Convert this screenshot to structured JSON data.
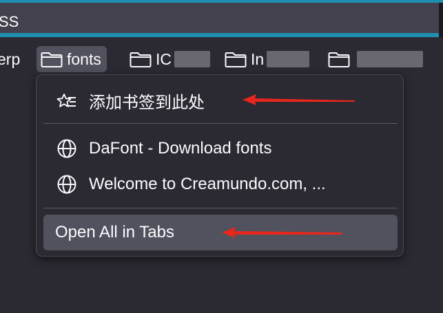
{
  "url_bar": {
    "text": "SS"
  },
  "bookmarks": [
    {
      "label": "erp"
    },
    {
      "label": "fonts"
    },
    {
      "label": "IC"
    },
    {
      "label": "In"
    },
    {
      "label": ""
    }
  ],
  "menu": {
    "items": [
      {
        "label": "添加书签到此处",
        "icon": "bookmark-add-icon"
      },
      {
        "label": "DaFont - Download fonts",
        "icon": "globe-icon"
      },
      {
        "label": "Welcome to Creamundo.com, ...",
        "icon": "globe-icon"
      },
      {
        "label": "Open All in Tabs",
        "icon": ""
      }
    ]
  },
  "colors": {
    "accent": "#1f8fb0",
    "annotation_arrow": "#e8261c",
    "menu_bg": "#2b2a33",
    "highlight": "#52525e"
  }
}
